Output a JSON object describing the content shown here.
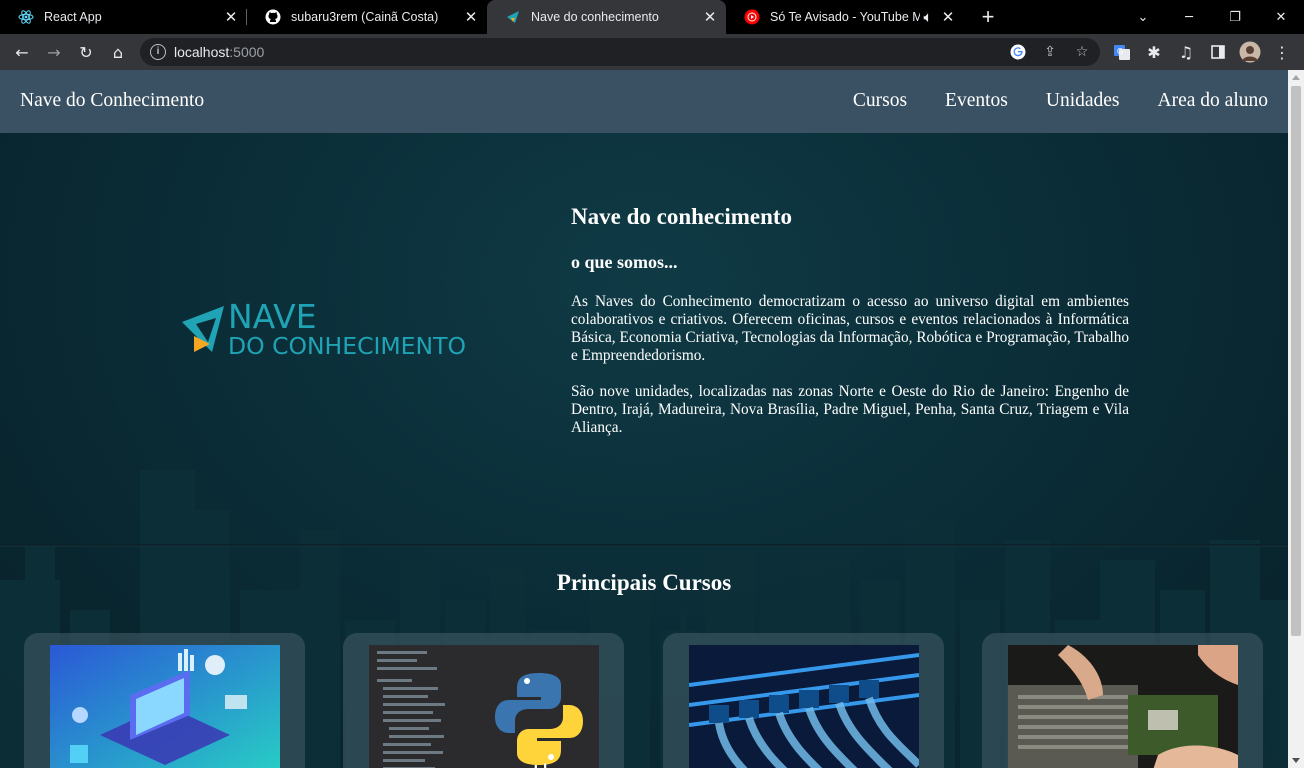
{
  "browser": {
    "tabs": [
      {
        "title": "React App",
        "icon": "react-icon",
        "active": false
      },
      {
        "title": "subaru3rem (Cainã Costa)",
        "icon": "github-icon",
        "active": false
      },
      {
        "title": "Nave do conhecimento",
        "icon": "nave-icon",
        "active": true
      },
      {
        "title": "Só Te Avisado - YouTube Mu",
        "icon": "youtube-music-icon",
        "active": false
      }
    ],
    "url_host": "localhost",
    "url_port": ":5000"
  },
  "navbar": {
    "brand": "Nave do Conhecimento",
    "links": [
      "Cursos",
      "Eventos",
      "Unidades",
      "Area do aluno"
    ]
  },
  "logo": {
    "line1": "NAVE",
    "line2": "DO CONHECIMENTO",
    "color_teal": "#1fa3b5",
    "color_orange": "#f5a623"
  },
  "about": {
    "title": "Nave do conhecimento",
    "subtitle": "o que somos...",
    "paragraph1": "As Naves do Conhecimento democratizam o acesso ao universo digital em ambientes colaborativos e criativos. Oferecem oficinas, cursos e eventos relacionados à Informática Básica, Economia Criativa, Tecnologias da Informação, Robótica e Programação, Trabalho e Empreendedorismo.",
    "paragraph2": "São nove unidades, localizadas nas zonas Norte e Oeste do Rio de Janeiro: Engenho de Dentro, Irajá, Madureira, Nova Brasília, Padre Miguel, Penha, Santa Cruz, Triagem e Vila Aliança."
  },
  "courses": {
    "title": "Principais Cursos",
    "python_label": "python"
  }
}
